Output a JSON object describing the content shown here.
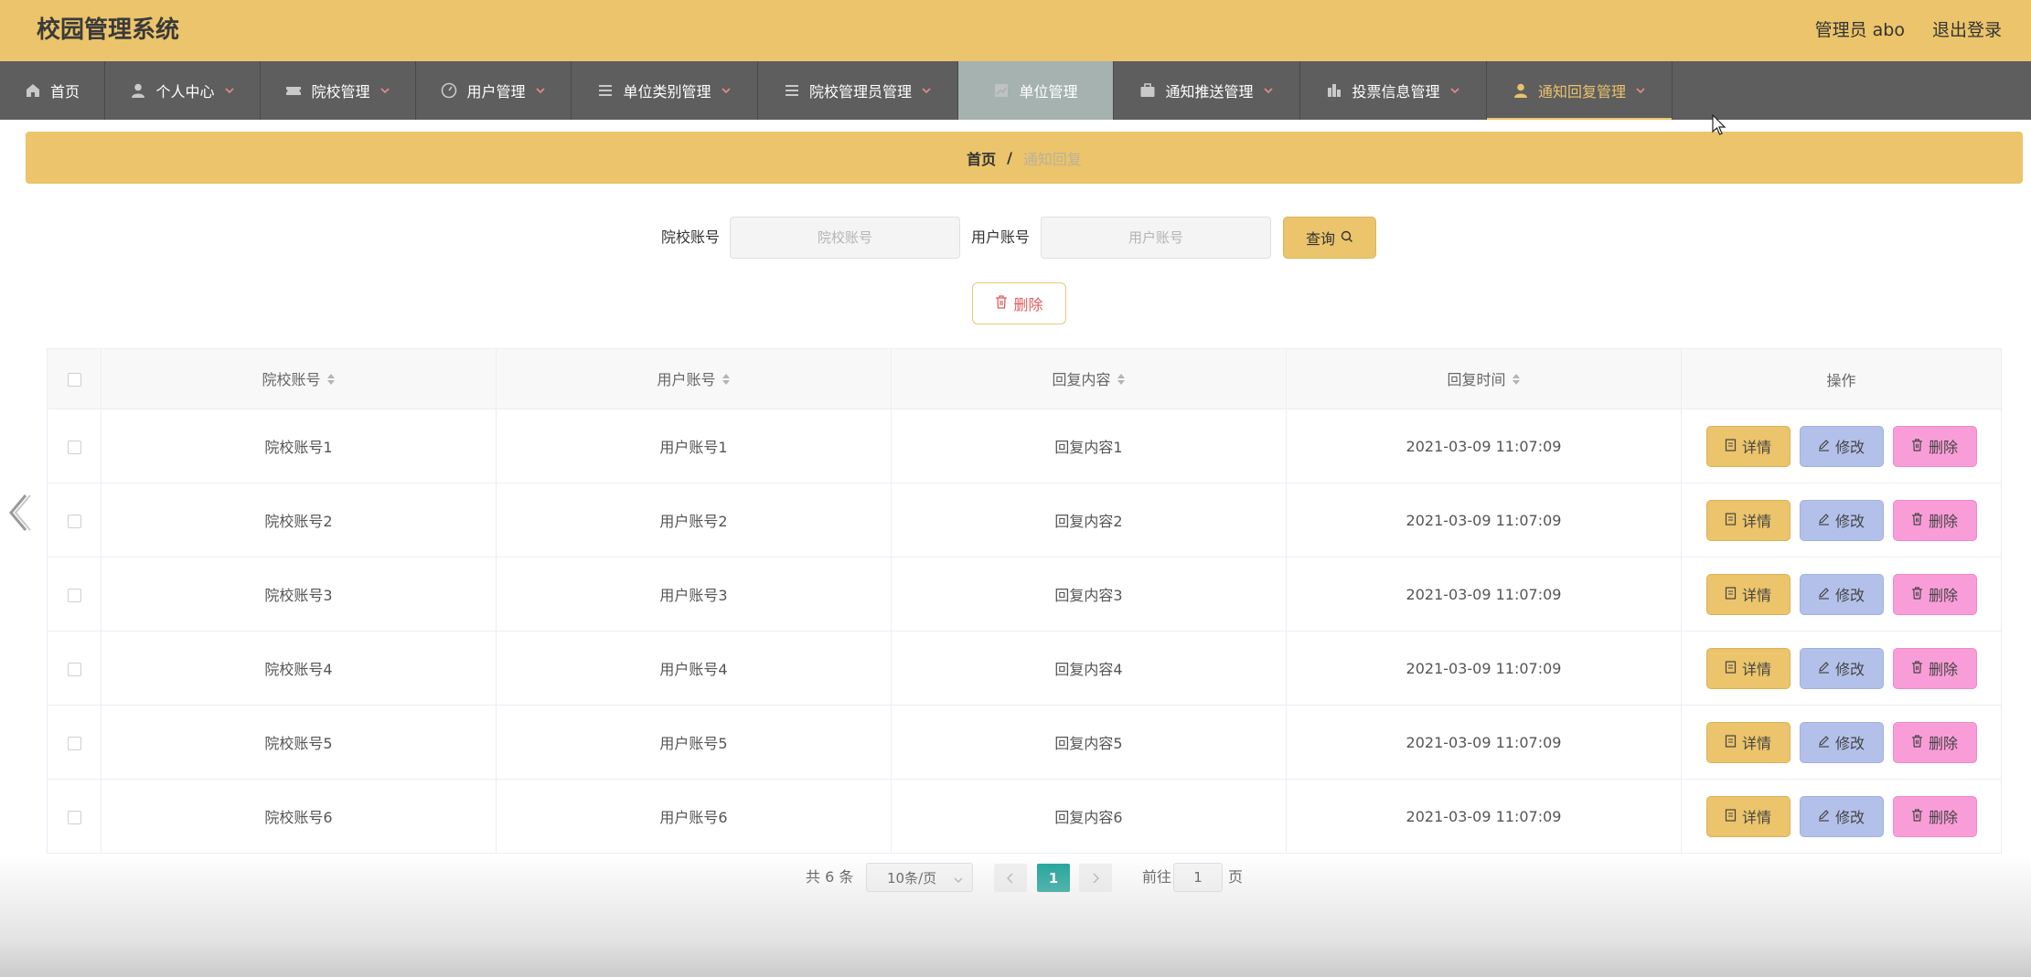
{
  "header": {
    "title": "校园管理系统",
    "admin_label": "管理员 abo",
    "logout_label": "退出登录",
    "bg_color": "#ebc46b"
  },
  "nav": {
    "items": [
      {
        "label": "首页",
        "icon": "home-icon",
        "has_dropdown": false
      },
      {
        "label": "个人中心",
        "icon": "user-icon",
        "has_dropdown": true
      },
      {
        "label": "院校管理",
        "icon": "ticket-icon",
        "has_dropdown": true
      },
      {
        "label": "用户管理",
        "icon": "gauge-icon",
        "has_dropdown": true
      },
      {
        "label": "单位类别管理",
        "icon": "list-icon",
        "has_dropdown": true
      },
      {
        "label": "院校管理员管理",
        "icon": "list-icon",
        "has_dropdown": true
      },
      {
        "label": "单位管理",
        "icon": "chart-icon",
        "has_dropdown": false,
        "state": "hover"
      },
      {
        "label": "通知推送管理",
        "icon": "briefcase-icon",
        "has_dropdown": true
      },
      {
        "label": "投票信息管理",
        "icon": "bar-icon",
        "has_dropdown": true
      },
      {
        "label": "通知回复管理",
        "icon": "user-icon",
        "has_dropdown": true,
        "state": "current"
      }
    ]
  },
  "breadcrumb": {
    "home": "首页",
    "separator": "/",
    "current": "通知回复"
  },
  "search": {
    "school_label": "院校账号",
    "school_placeholder": "院校账号",
    "user_label": "用户账号",
    "user_placeholder": "用户账号",
    "query_label": "查询",
    "delete_label": "删除"
  },
  "table": {
    "columns": [
      "院校账号",
      "用户账号",
      "回复内容",
      "回复时间",
      "操作"
    ],
    "actions": {
      "detail": "详情",
      "edit": "修改",
      "delete": "删除"
    },
    "rows": [
      {
        "school": "院校账号1",
        "user": "用户账号1",
        "content": "回复内容1",
        "time": "2021-03-09 11:07:09"
      },
      {
        "school": "院校账号2",
        "user": "用户账号2",
        "content": "回复内容2",
        "time": "2021-03-09 11:07:09"
      },
      {
        "school": "院校账号3",
        "user": "用户账号3",
        "content": "回复内容3",
        "time": "2021-03-09 11:07:09"
      },
      {
        "school": "院校账号4",
        "user": "用户账号4",
        "content": "回复内容4",
        "time": "2021-03-09 11:07:09"
      },
      {
        "school": "院校账号5",
        "user": "用户账号5",
        "content": "回复内容5",
        "time": "2021-03-09 11:07:09"
      },
      {
        "school": "院校账号6",
        "user": "用户账号6",
        "content": "回复内容6",
        "time": "2021-03-09 11:07:09"
      }
    ]
  },
  "pagination": {
    "total_text": "共 6 条",
    "page_size": "10条/页",
    "current_page": "1",
    "goto_label": "前往",
    "goto_value": "1",
    "page_unit": "页"
  },
  "colors": {
    "accent": "#ebc46b",
    "nav_bg": "#5e5e5e",
    "pager_active": "#1aa398",
    "edit": "#b3c1ea",
    "delete": "#f99dd8"
  }
}
